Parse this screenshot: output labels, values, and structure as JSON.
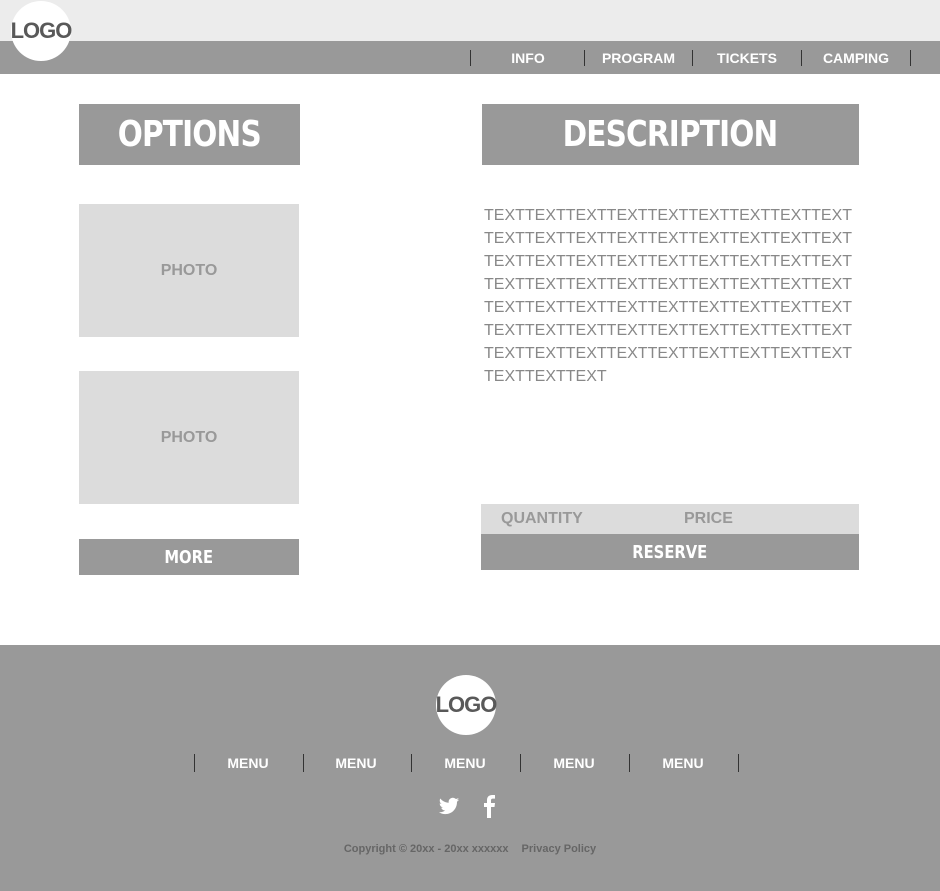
{
  "header": {
    "logo_text": "LOGO",
    "nav": [
      "INFO",
      "PROGRAM",
      "TICKETS",
      "CAMPING"
    ]
  },
  "options": {
    "heading": "OPTIONS",
    "photos": [
      "PHOTO",
      "PHOTO"
    ],
    "more_label": "MORE"
  },
  "description": {
    "heading": "DESCRIPTION",
    "body": "TEXTTEXTTEXTTEXTTEXTTEXTTEXTTEXTTEXTTEXTTEXTTEXTTEXTTEXTTEXTTEXTTEXTTEXTTEXTTEXTTEXTTEXTTEXTTEXTTEXTTEXTTEXTTEXTTEXTTEXTTEXTTEXTTEXTTEXTTEXTTEXTTEXTTEXTTEXTTEXTTEXTTEXTTEXTTEXTTEXTTEXTTEXTTEXTTEXTTEXTTEXTTEXTTEXTTEXTTEXTTEXTTEXTTEXTTEXTTEXTTEXTTEXTTEXTTEXTTEXTTEXT",
    "quantity_label": "QUANTITY",
    "price_label": "PRICE",
    "reserve_label": "RESERVE"
  },
  "footer": {
    "logo_text": "LOGO",
    "menu": [
      "MENU",
      "MENU",
      "MENU",
      "MENU",
      "MENU"
    ],
    "social_icons": [
      "twitter-icon",
      "facebook-icon"
    ],
    "copyright": "Copyright © 20xx - 20xx xxxxxx",
    "privacy": "Privacy Policy"
  },
  "colors": {
    "bar_gray": "#999999",
    "light_gray": "#dcdcdc",
    "top_strip": "#ececec"
  }
}
